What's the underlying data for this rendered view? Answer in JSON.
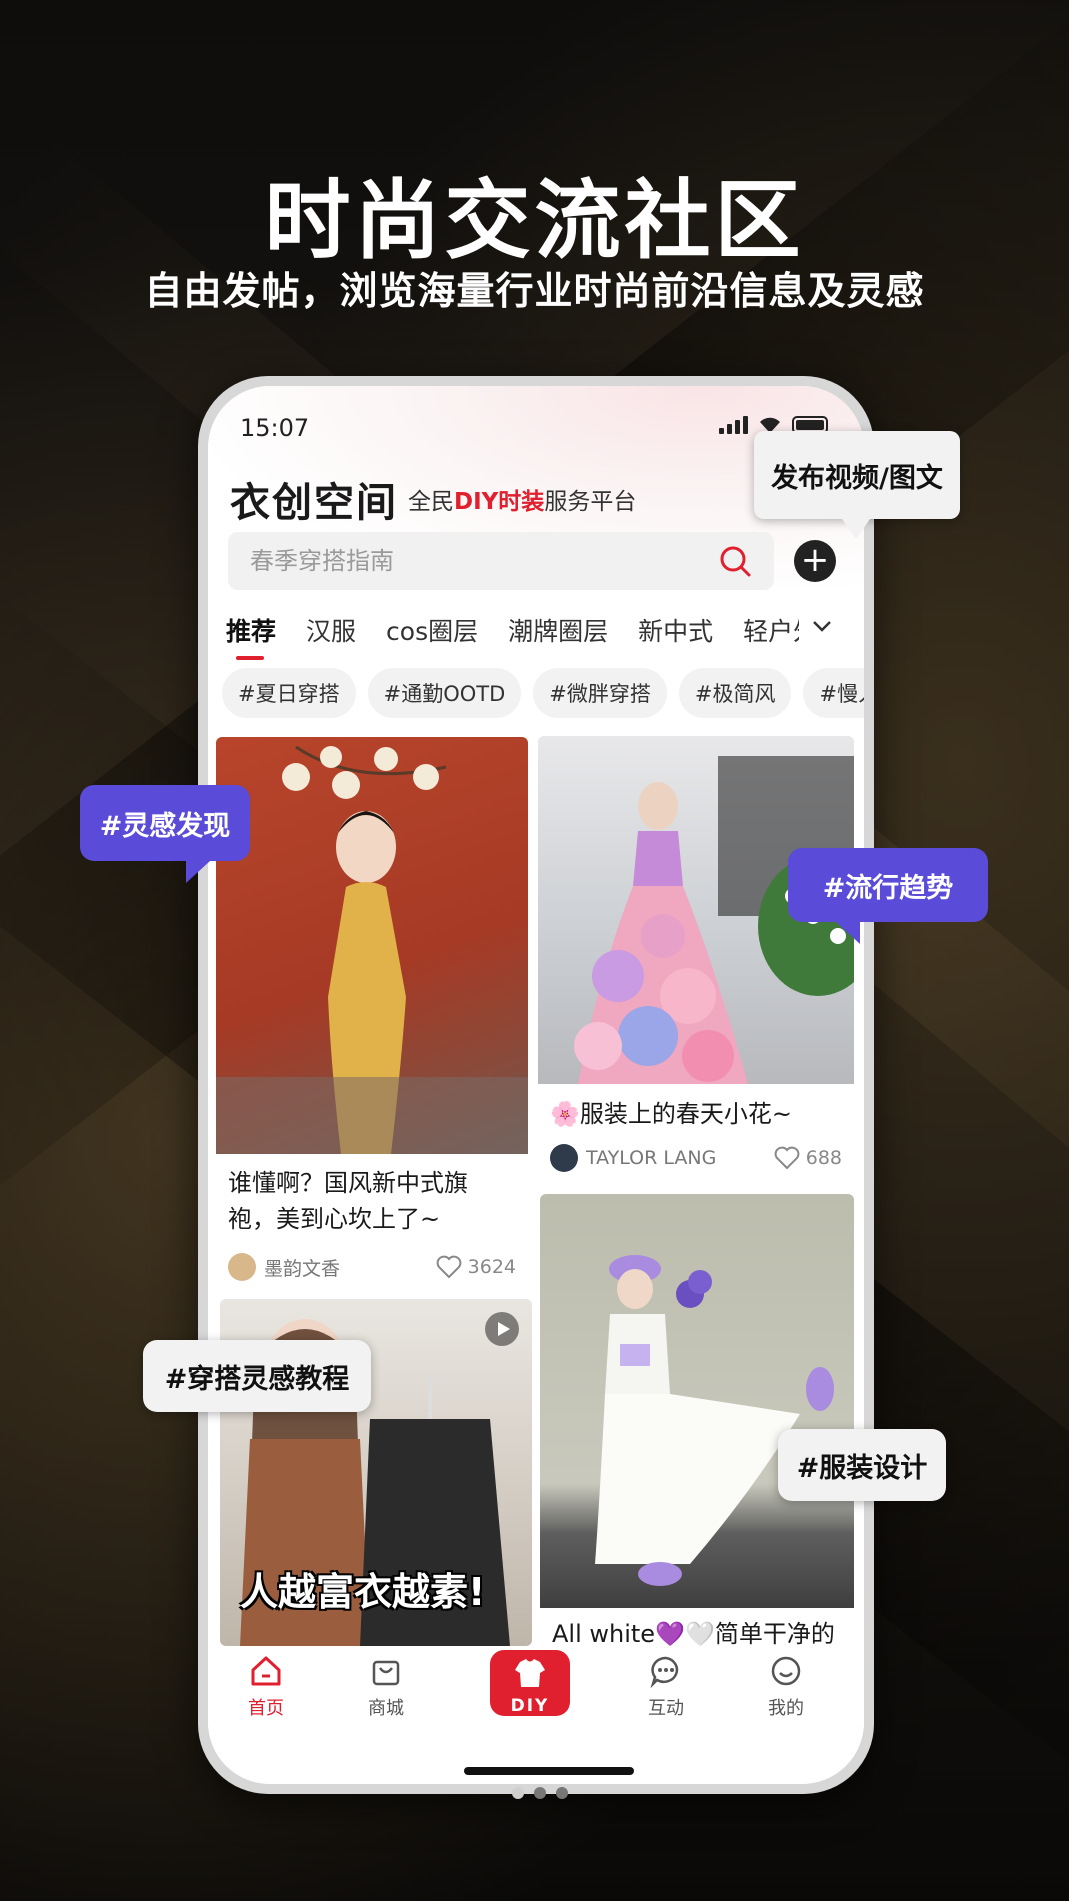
{
  "promo": {
    "headline": "时尚交流社区",
    "subline": "自由发帖，浏览海量行业时尚前沿信息及灵感"
  },
  "status_bar": {
    "time": "15:07"
  },
  "app": {
    "logo": "衣创空间",
    "slogan_prefix": "全民",
    "slogan_highlight": "DIY时装",
    "slogan_suffix": "服务平台"
  },
  "search": {
    "placeholder": "春季穿搭指南"
  },
  "tabs": [
    "推荐",
    "汉服",
    "cos圈层",
    "潮牌圈层",
    "新中式",
    "轻户外"
  ],
  "chips": [
    "#夏日穿搭",
    "#通勤OOTD",
    "#微胖穿搭",
    "#极简风",
    "#慢人"
  ],
  "feed": [
    {
      "title": "谁懂啊？国风新中式旗袍，美到心坎上了~",
      "author": "墨韵文香",
      "likes": "3624"
    },
    {
      "title": "🌸服装上的春天小花~",
      "author": "TAYLOR LANG",
      "likes": "688"
    },
    {
      "overlay_text": "人越富衣越素!"
    },
    {
      "title": "All white💜🤍简单干净的"
    }
  ],
  "bottom_nav": [
    "首页",
    "商城",
    "DIY",
    "互动",
    "我的"
  ],
  "callouts": {
    "publish": "发布视频/图文",
    "inspiration": "#灵感发现",
    "trend": "#流行趋势",
    "tutorial": "#穿搭灵感教程",
    "design": "#服装设计"
  },
  "colors": {
    "accent": "#e0202e",
    "callout_purple": "#5a4bd8"
  }
}
